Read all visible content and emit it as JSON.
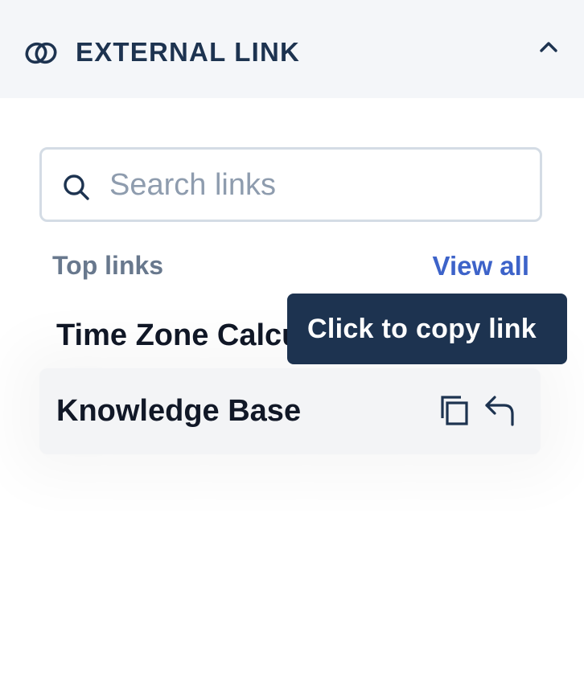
{
  "header": {
    "title": "EXTERNAL LINK",
    "icon": "link-icon",
    "collapse_icon": "chevron-up-icon"
  },
  "search": {
    "placeholder": "Search links",
    "value": "",
    "icon": "search-icon"
  },
  "section": {
    "label": "Top links",
    "view_all_label": "View all"
  },
  "links": [
    {
      "label": "Time Zone Calculator"
    },
    {
      "label": "Knowledge Base",
      "actions": [
        "copy-icon",
        "reply-icon"
      ]
    }
  ],
  "tooltip": {
    "text": "Click to copy link"
  },
  "colors": {
    "header_bg": "#f4f6f9",
    "title": "#1d3350",
    "accent": "#3d63c9",
    "tooltip_bg": "#1d3350",
    "hover_row_bg": "#f3f4f6"
  }
}
